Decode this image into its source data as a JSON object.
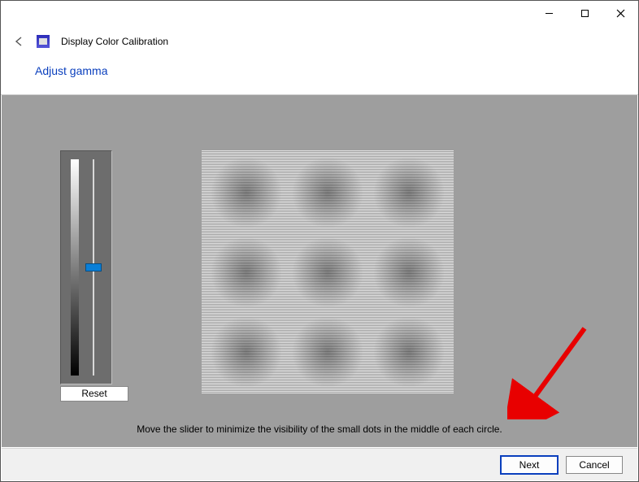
{
  "titlebar": {
    "minimize": "—",
    "maximize": "▢",
    "close": "✕"
  },
  "header": {
    "app_title": "Display Color Calibration",
    "page_title": "Adjust gamma"
  },
  "controls": {
    "reset_label": "Reset",
    "slider_value": 50
  },
  "instruction": "Move the slider to minimize the visibility of the small dots in the middle of each circle.",
  "footer": {
    "next_label": "Next",
    "cancel_label": "Cancel"
  }
}
